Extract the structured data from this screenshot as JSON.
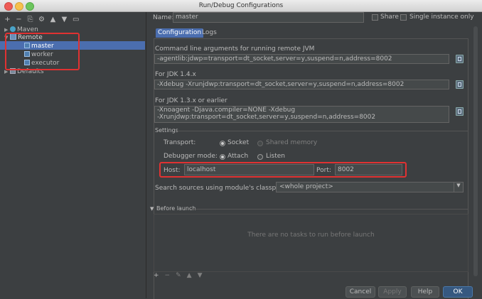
{
  "window": {
    "title": "Run/Debug Configurations"
  },
  "toolbar": {
    "add": "+",
    "remove": "−",
    "copy": "⎘",
    "edit": "⚙",
    "up": "▲",
    "down": "▼",
    "folder": "▭"
  },
  "tree": {
    "maven": "Maven",
    "remote": "Remote",
    "items": [
      "master",
      "worker",
      "executor"
    ],
    "defaults": "Defaults"
  },
  "config": {
    "name_label": "Name:",
    "name_value": "master",
    "share_label": "Share",
    "single_instance_label": "Single instance only",
    "tabs": [
      "Configuration",
      "Logs"
    ],
    "cmd_label": "Command line arguments for running remote JVM",
    "cmd_value": "-agentlib:jdwp=transport=dt_socket,server=y,suspend=n,address=8002",
    "jdk14_label": "For JDK 1.4.x",
    "jdk14_value": "-Xdebug -Xrunjdwp:transport=dt_socket,server=y,suspend=n,address=8002",
    "jdk13_label": "For JDK 1.3.x or earlier",
    "jdk13_line1": "-Xnoagent -Djava.compiler=NONE -Xdebug",
    "jdk13_line2": "-Xrunjdwp:transport=dt_socket,server=y,suspend=n,address=8002",
    "settings_label": "Settings",
    "transport_label": "Transport:",
    "socket_label": "Socket",
    "shared_memory_label": "Shared memory",
    "debugger_mode_label": "Debugger mode:",
    "attach_label": "Attach",
    "listen_label": "Listen",
    "host_label": "Host:",
    "host_value": "localhost",
    "port_label": "Port:",
    "port_value": "8002",
    "classpath_label": "Search sources using module's classpath:",
    "classpath_value": "<whole project>",
    "before_launch_label": "Before launch",
    "no_tasks": "There are no tasks to run before launch",
    "bl_tools": {
      "add": "+",
      "remove": "−",
      "edit": "✎",
      "up": "▲",
      "down": "▼"
    }
  },
  "buttons": {
    "cancel": "Cancel",
    "apply": "Apply",
    "help": "Help",
    "ok": "OK"
  },
  "colors": {
    "highlight_box": "#e03232",
    "selection": "#4b6eaf",
    "background": "#3c3f41"
  }
}
